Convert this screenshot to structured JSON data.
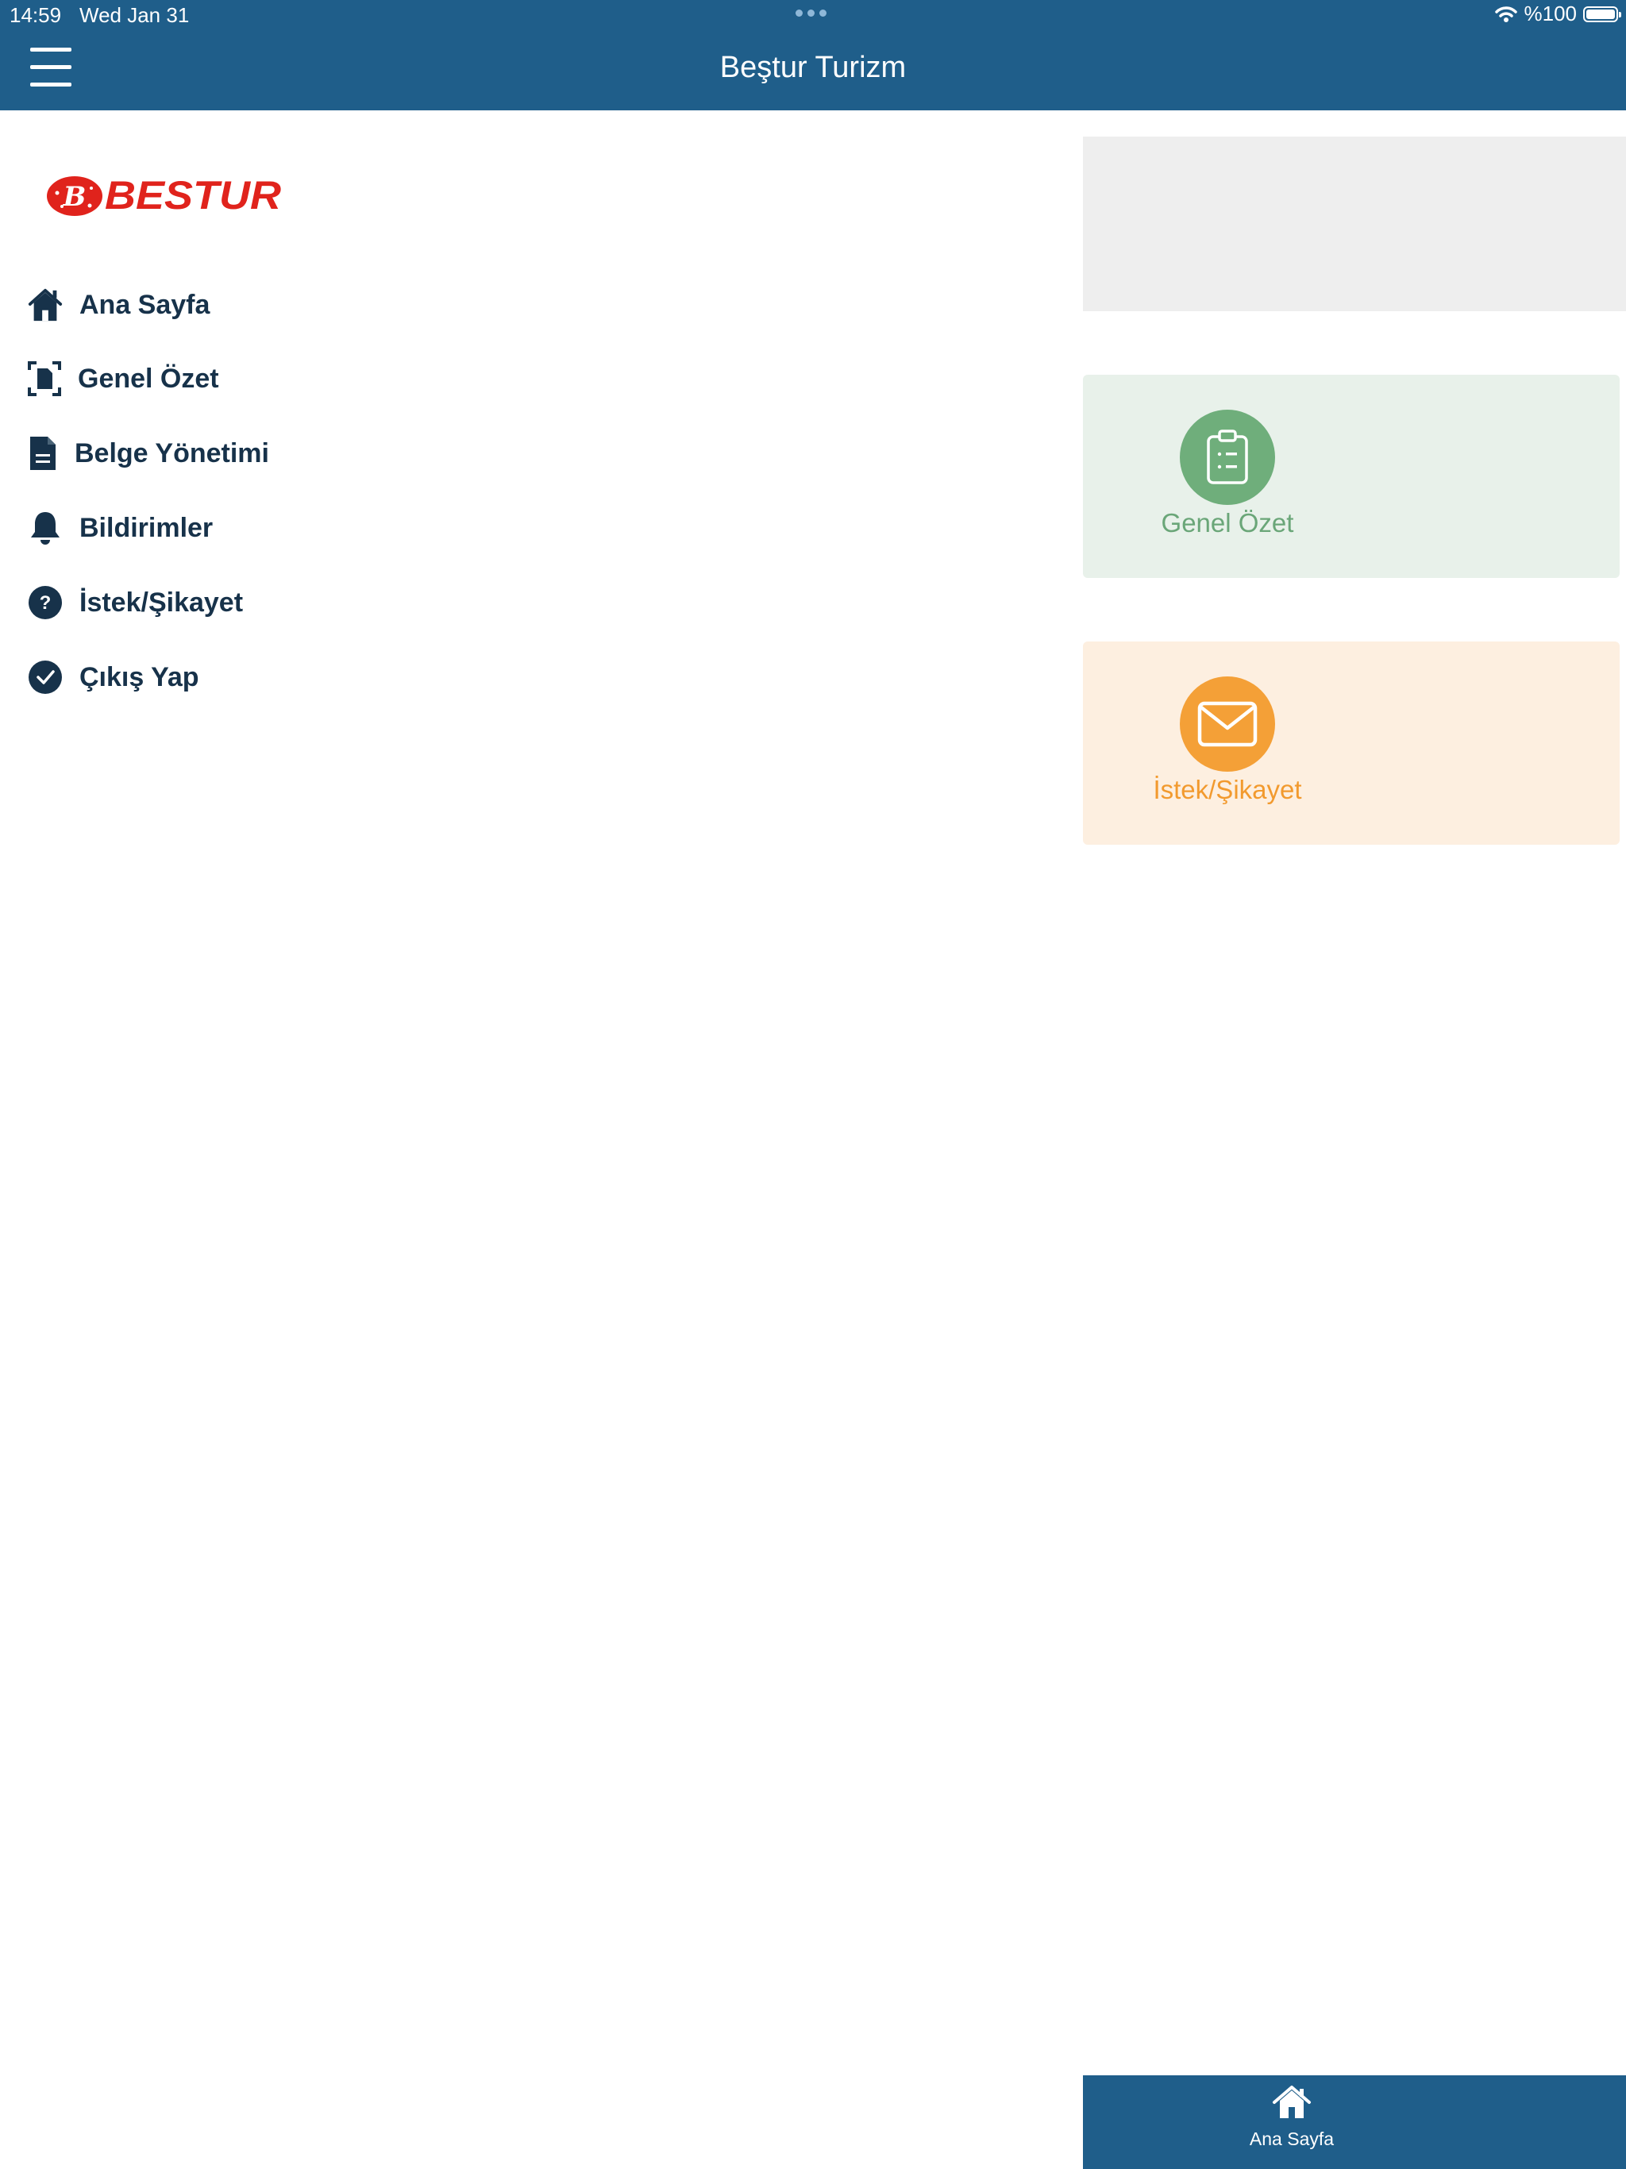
{
  "status_bar": {
    "time": "14:59",
    "date": "Wed Jan 31",
    "battery_text": "%100"
  },
  "header": {
    "title": "Beştur Turizm",
    "color": "#1f5e8a"
  },
  "logo": {
    "text": "BESTUR",
    "mark": "B",
    "color": "#e0231c"
  },
  "menu": {
    "items": [
      {
        "label": "Ana Sayfa",
        "icon": "home-icon"
      },
      {
        "label": "Genel Özet",
        "icon": "document-scan-icon"
      },
      {
        "label": "Belge Yönetimi",
        "icon": "file-icon"
      },
      {
        "label": "Bildirimler",
        "icon": "bell-icon"
      },
      {
        "label": "İstek/Şikayet",
        "icon": "question-circle-icon"
      },
      {
        "label": "Çıkış Yap",
        "icon": "check-circle-icon"
      }
    ],
    "text_color": "#17324a"
  },
  "tiles": [
    {
      "label": "Genel Özet",
      "icon": "clipboard-icon",
      "color": "#6fae7b",
      "background": "#e8f1ea"
    },
    {
      "label": "İstek/Şikayet",
      "icon": "envelope-icon",
      "color": "#f4a037",
      "background": "#fdefe0"
    }
  ],
  "tab_bar": {
    "items": [
      {
        "label": "Ana Sayfa",
        "icon": "home-icon"
      }
    ]
  }
}
